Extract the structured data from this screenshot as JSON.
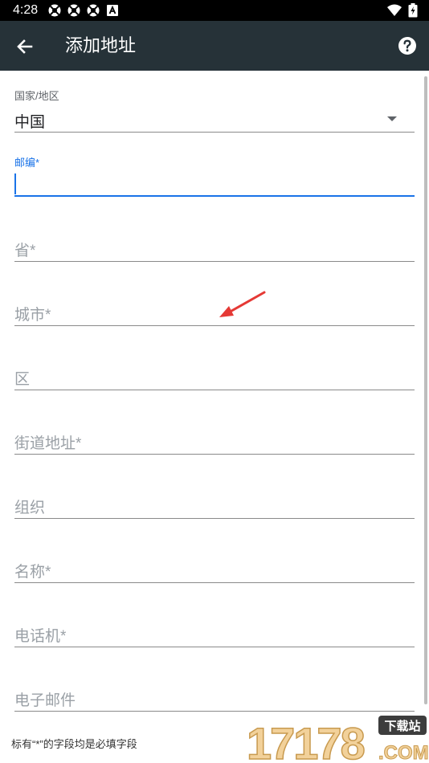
{
  "status_bar": {
    "time": "4:28",
    "icons": [
      "notification-icon",
      "notification-icon",
      "notification-icon",
      "a-icon",
      "wifi-icon",
      "battery-icon"
    ]
  },
  "app_bar": {
    "title": "添加地址",
    "back_icon": "back-arrow-icon",
    "help_icon": "help-icon",
    "color": "#263238"
  },
  "form": {
    "country": {
      "label": "国家/地区",
      "value": "中国"
    },
    "postal_code": {
      "label": "邮编*",
      "value": ""
    },
    "province": {
      "placeholder": "省*"
    },
    "city": {
      "placeholder": "城市*"
    },
    "district": {
      "placeholder": "区"
    },
    "street": {
      "placeholder": "街道地址*"
    },
    "organization": {
      "placeholder": "组织"
    },
    "name": {
      "placeholder": "名称*"
    },
    "phone": {
      "placeholder": "电话机*"
    },
    "email": {
      "placeholder": "电子邮件"
    }
  },
  "footer": {
    "note": "标有“*”的字段均是必填字段"
  },
  "watermark": {
    "main": "17178",
    "badge": "下载站",
    "sub": ".COM"
  },
  "accent_color": "#1a73e8"
}
